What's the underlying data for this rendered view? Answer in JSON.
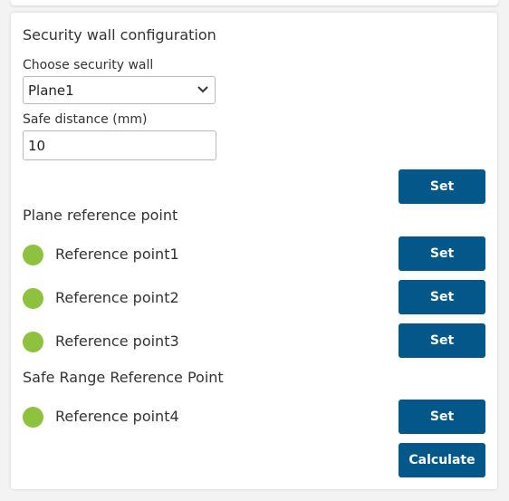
{
  "panel": {
    "title": "Security wall configuration",
    "wall_label": "Choose security wall",
    "wall_value": "Plane1",
    "distance_label": "Safe distance (mm)",
    "distance_value": "10",
    "set_label": "Set",
    "plane_section": "Plane reference point",
    "safe_section": "Safe Range Reference Point",
    "calculate_label": "Calculate",
    "status_color": "#8dc13e",
    "accent_color": "#035889",
    "points": [
      {
        "label": "Reference point1",
        "status": "green-indicator"
      },
      {
        "label": "Reference point2",
        "status": "green-indicator"
      },
      {
        "label": "Reference point3",
        "status": "green-indicator"
      },
      {
        "label": "Reference point4",
        "status": "green-indicator"
      }
    ]
  }
}
